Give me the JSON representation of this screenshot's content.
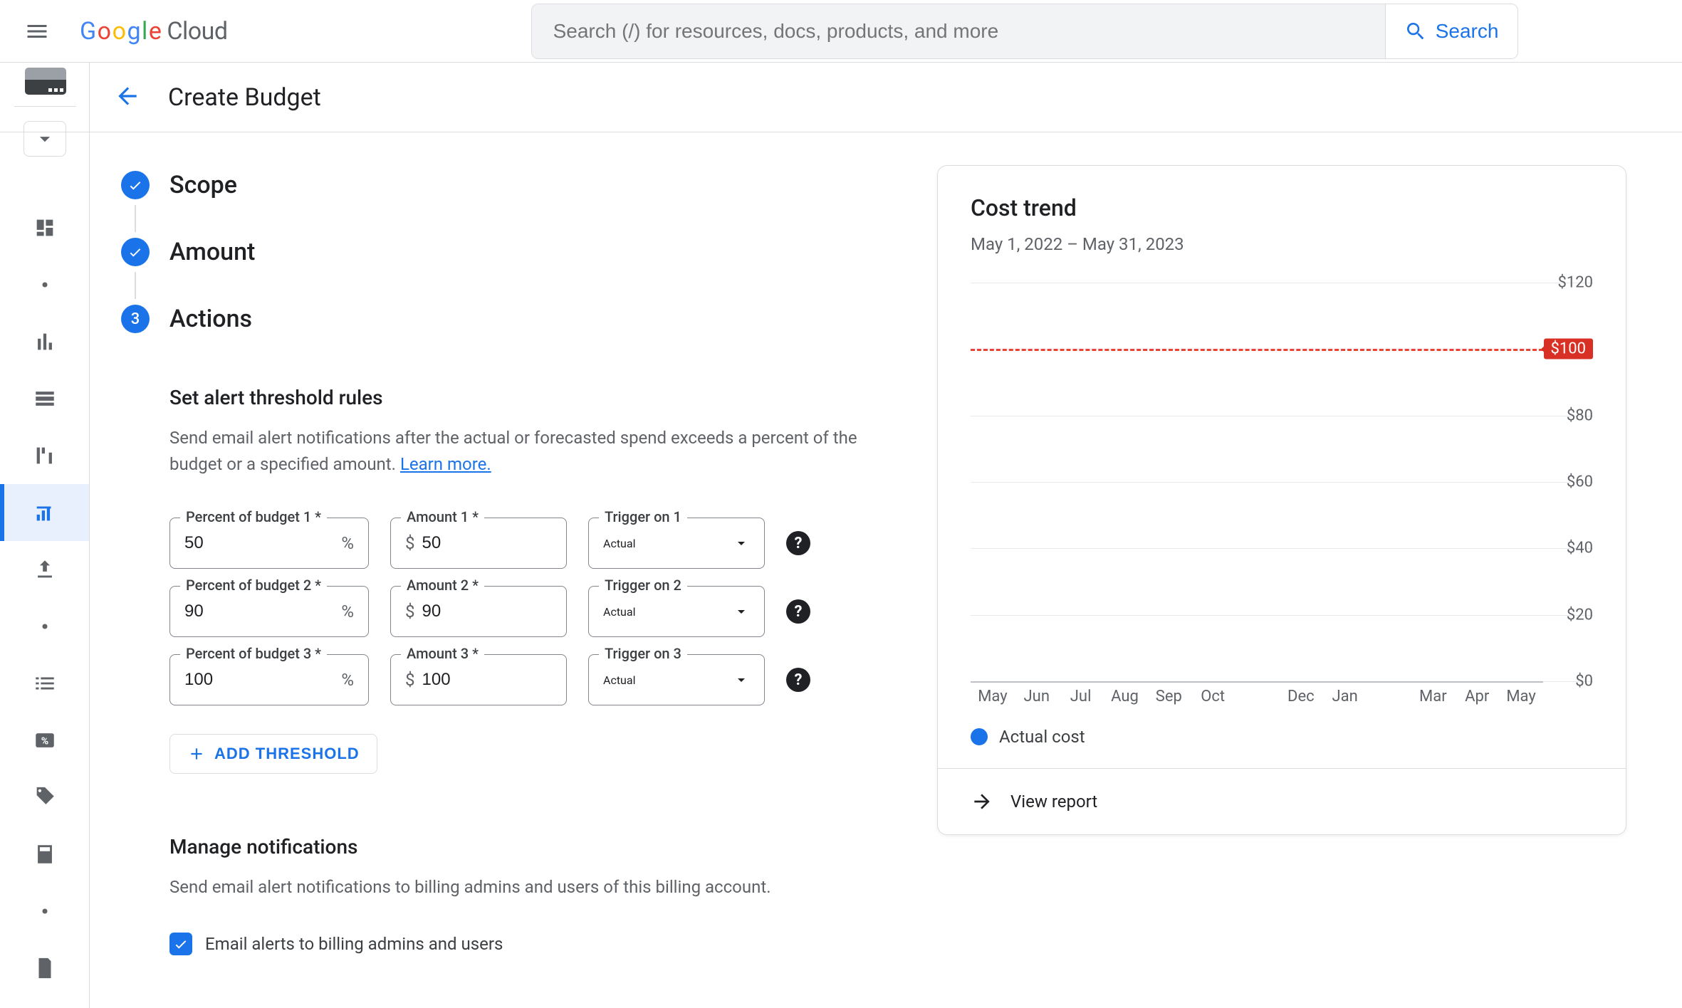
{
  "header": {
    "search_placeholder": "Search (/) for resources, docs, products, and more",
    "search_button": "Search",
    "logo_cloud": "Cloud"
  },
  "page": {
    "title": "Create Budget"
  },
  "stepper": {
    "step1": "Scope",
    "step2": "Amount",
    "step3_num": "3",
    "step3": "Actions"
  },
  "alerts": {
    "heading": "Set alert threshold rules",
    "desc_a": "Send email alert notifications after the actual or forecasted spend exceeds a percent of the budget or a specified amount. ",
    "learn_more": "Learn more.",
    "rows": [
      {
        "pct_label": "Percent of budget 1 *",
        "pct": "50",
        "amt_label": "Amount 1 *",
        "amt": "50",
        "trg_label": "Trigger on 1",
        "trg": "Actual"
      },
      {
        "pct_label": "Percent of budget 2 *",
        "pct": "90",
        "amt_label": "Amount 2 *",
        "amt": "90",
        "trg_label": "Trigger on 2",
        "trg": "Actual"
      },
      {
        "pct_label": "Percent of budget 3 *",
        "pct": "100",
        "amt_label": "Amount 3 *",
        "amt": "100",
        "trg_label": "Trigger on 3",
        "trg": "Actual"
      }
    ],
    "add_threshold": "ADD THRESHOLD"
  },
  "notify": {
    "heading": "Manage notifications",
    "desc": "Send email alert notifications to billing admins and users of this billing account.",
    "checkbox": "Email alerts to billing admins and users"
  },
  "cost_trend": {
    "title": "Cost trend",
    "range": "May 1, 2022 – May 31, 2023",
    "legend": "Actual cost",
    "view_report": "View report",
    "budget_tag": "$100"
  },
  "chart_data": {
    "type": "bar",
    "title": "Cost trend",
    "xlabel": "",
    "ylabel": "",
    "ylim": [
      0,
      120
    ],
    "y_ticks": [
      0,
      20,
      40,
      60,
      80,
      100,
      120
    ],
    "y_tick_labels": [
      "$0",
      "$20",
      "$40",
      "$60",
      "$80",
      "",
      "$120"
    ],
    "budget_line": 100,
    "categories": [
      "May",
      "Jun",
      "Jul",
      "Aug",
      "Sep",
      "Oct",
      "",
      "Dec",
      "Jan",
      "",
      "Mar",
      "Apr",
      "May"
    ],
    "series": [
      {
        "name": "Actual cost",
        "values": [
          0,
          0,
          0,
          0,
          0,
          0,
          0,
          0,
          0,
          0,
          0,
          0,
          0
        ]
      }
    ]
  }
}
